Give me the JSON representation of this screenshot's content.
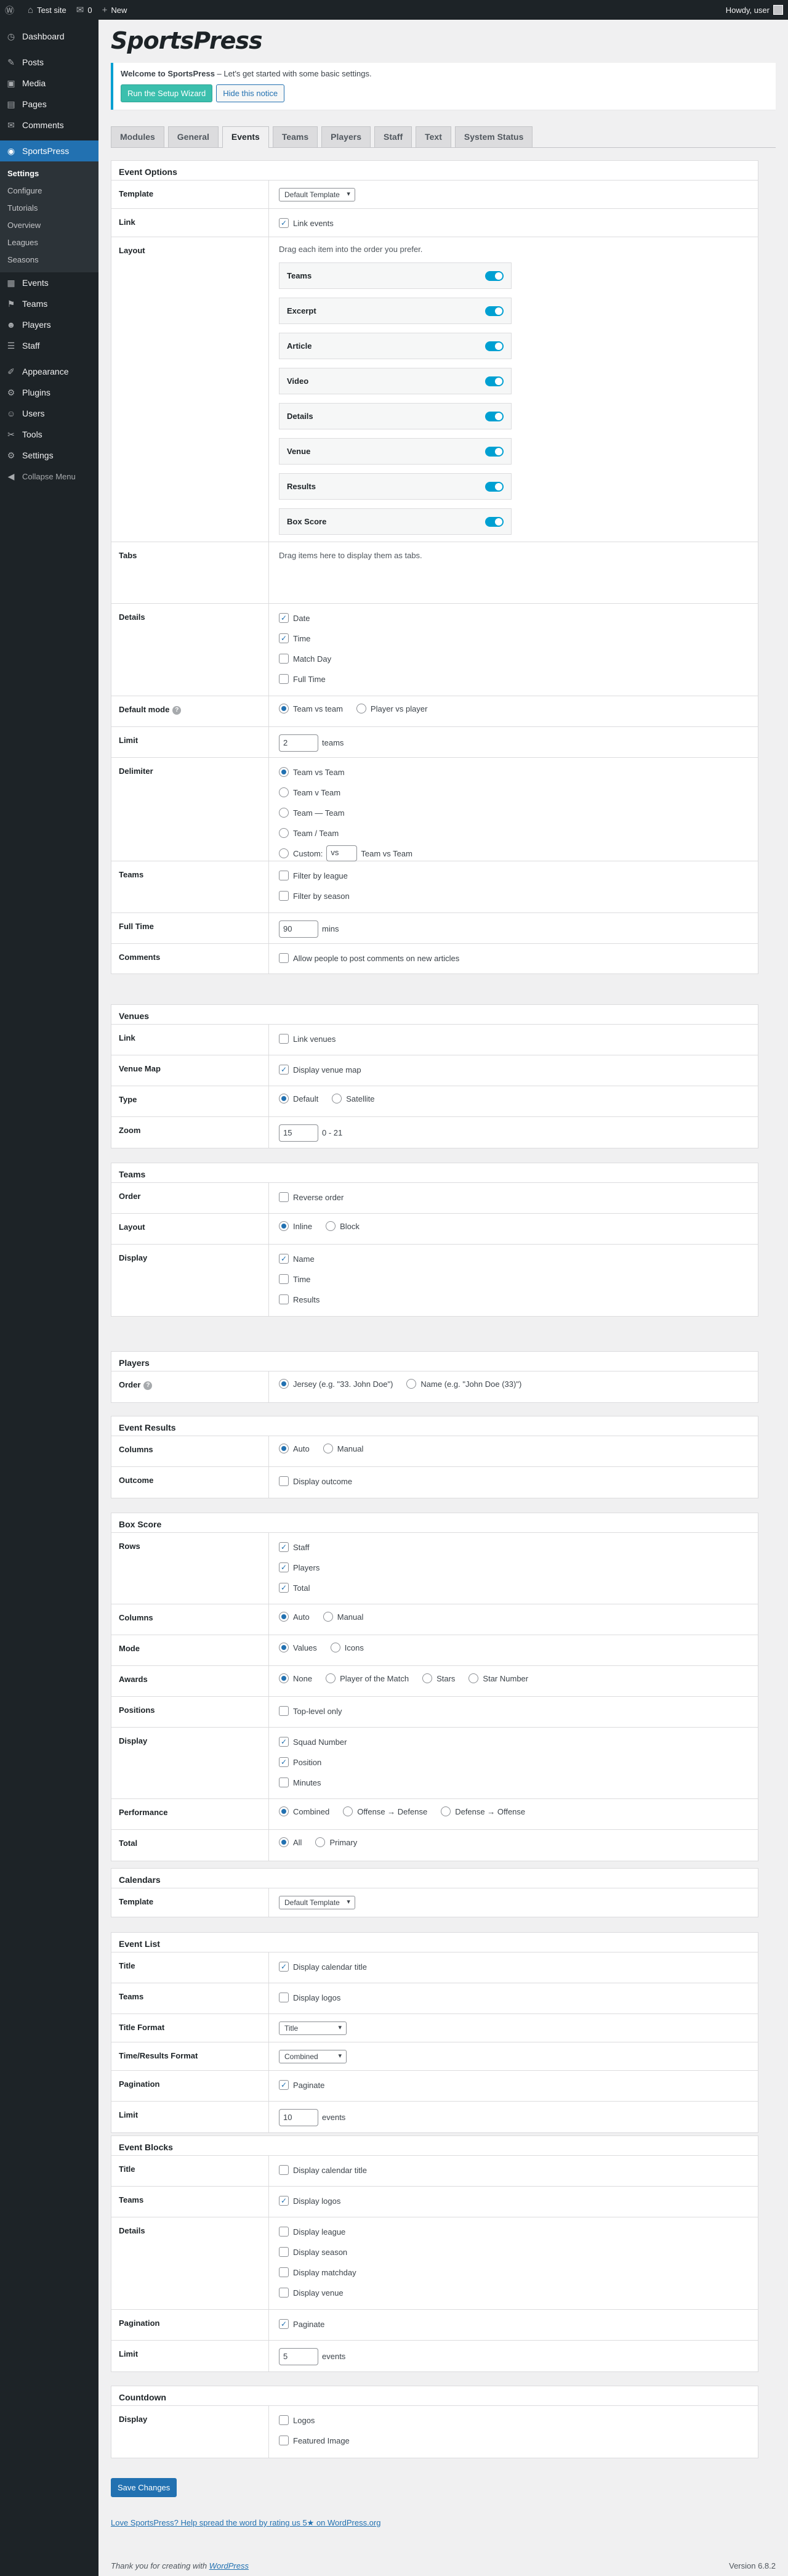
{
  "adminbar": {
    "site": "Test site",
    "comments": "0",
    "new": "New",
    "howdy": "Howdy, user"
  },
  "sidebar": {
    "items": [
      {
        "label": "Dashboard",
        "icon": "dashboard-icon",
        "glyph": "◷"
      },
      {
        "label": "Posts",
        "icon": "pin-icon",
        "glyph": "✎"
      },
      {
        "label": "Media",
        "icon": "media-icon",
        "glyph": "▣"
      },
      {
        "label": "Pages",
        "icon": "page-icon",
        "glyph": "▤"
      },
      {
        "label": "Comments",
        "icon": "comment-icon",
        "glyph": "✉"
      },
      {
        "label": "SportsPress",
        "icon": "sportspress-icon",
        "glyph": "◉"
      },
      {
        "label": "Events",
        "icon": "calendar-icon",
        "glyph": "▦"
      },
      {
        "label": "Teams",
        "icon": "teams-icon",
        "glyph": "⚑"
      },
      {
        "label": "Players",
        "icon": "players-icon",
        "glyph": "☻"
      },
      {
        "label": "Staff",
        "icon": "staff-icon",
        "glyph": "☰"
      },
      {
        "label": "Appearance",
        "icon": "appearance-icon",
        "glyph": "✐"
      },
      {
        "label": "Plugins",
        "icon": "plugins-icon",
        "glyph": "⚙"
      },
      {
        "label": "Users",
        "icon": "users-icon",
        "glyph": "☺"
      },
      {
        "label": "Tools",
        "icon": "tools-icon",
        "glyph": "✂"
      },
      {
        "label": "Settings",
        "icon": "settings-icon",
        "glyph": "⚙"
      }
    ],
    "sub": [
      "Settings",
      "Configure",
      "Tutorials",
      "Overview",
      "Leagues",
      "Seasons"
    ],
    "collapse": "Collapse Menu"
  },
  "logo": "SportsPress",
  "notice": {
    "strong": "Welcome to SportsPress",
    "text": " – Let's get started with some basic settings.",
    "wizard": "Run the Setup Wizard",
    "hide": "Hide this notice"
  },
  "tabs": [
    "Modules",
    "General",
    "Events",
    "Teams",
    "Players",
    "Staff",
    "Text",
    "System Status"
  ],
  "event_options": {
    "title": "Event Options",
    "template_label": "Template",
    "template_value": "Default Template",
    "link_label": "Link",
    "link_opt": "Link events",
    "layout_label": "Layout",
    "layout_hint": "Drag each item into the order you prefer.",
    "layout_items": [
      "Teams",
      "Excerpt",
      "Article",
      "Video",
      "Details",
      "Venue",
      "Results",
      "Box Score"
    ],
    "tabs_label": "Tabs",
    "tabs_hint": "Drag items here to display them as tabs.",
    "details_label": "Details",
    "details_opts": [
      "Date",
      "Time",
      "Match Day",
      "Full Time"
    ],
    "mode_label": "Default mode",
    "mode_opts": [
      "Team vs team",
      "Player vs player"
    ],
    "limit_label": "Limit",
    "limit_value": "2",
    "limit_unit": "teams",
    "delim_label": "Delimiter",
    "delim_opts": [
      "Team vs Team",
      "Team v Team",
      "Team — Team",
      "Team / Team"
    ],
    "custom_label": "Custom:",
    "custom_value": "vs",
    "custom_preview": "Team vs Team",
    "teams_label": "Teams",
    "teams_opts": [
      "Filter by league",
      "Filter by season"
    ],
    "fulltime_label": "Full Time",
    "fulltime_value": "90",
    "fulltime_unit": "mins",
    "comments_label": "Comments",
    "comments_opt": "Allow people to post comments on new articles"
  },
  "venues": {
    "title": "Venues",
    "link_label": "Link",
    "link_opt": "Link venues",
    "map_label": "Venue Map",
    "map_opt": "Display venue map",
    "type_label": "Type",
    "type_opts": [
      "Default",
      "Satellite"
    ],
    "zoom_label": "Zoom",
    "zoom_value": "15",
    "zoom_range": "0 - 21"
  },
  "teams": {
    "title": "Teams",
    "order_label": "Order",
    "order_opt": "Reverse order",
    "layout_label": "Layout",
    "layout_opts": [
      "Inline",
      "Block"
    ],
    "display_label": "Display",
    "display_opts": [
      "Name",
      "Time",
      "Results"
    ]
  },
  "players": {
    "title": "Players",
    "order_label": "Order",
    "order_opts": [
      "Jersey (e.g. \"33. John Doe\")",
      "Name (e.g. \"John Doe (33)\")"
    ]
  },
  "results": {
    "title": "Event Results",
    "columns_label": "Columns",
    "columns_opts": [
      "Auto",
      "Manual"
    ],
    "outcome_label": "Outcome",
    "outcome_opt": "Display outcome"
  },
  "boxscore": {
    "title": "Box Score",
    "rows_label": "Rows",
    "rows_opts": [
      "Staff",
      "Players",
      "Total"
    ],
    "columns_label": "Columns",
    "columns_opts": [
      "Auto",
      "Manual"
    ],
    "mode_label": "Mode",
    "mode_opts": [
      "Values",
      "Icons"
    ],
    "awards_label": "Awards",
    "awards_opts": [
      "None",
      "Player of the Match",
      "Stars",
      "Star Number"
    ],
    "positions_label": "Positions",
    "positions_opt": "Top-level only",
    "display_label": "Display",
    "display_opts": [
      "Squad Number",
      "Position",
      "Minutes"
    ],
    "perf_label": "Performance",
    "perf_opts": [
      "Combined",
      "Offense → Defense",
      "Defense → Offense"
    ],
    "total_label": "Total",
    "total_opts": [
      "All",
      "Primary"
    ]
  },
  "calendars": {
    "title": "Calendars",
    "template_label": "Template",
    "template_value": "Default Template"
  },
  "eventlist": {
    "title": "Event List",
    "title_label": "Title",
    "title_opt": "Display calendar title",
    "teams_label": "Teams",
    "teams_opt": "Display logos",
    "tf_label": "Title Format",
    "tf_value": "Title",
    "trf_label": "Time/Results Format",
    "trf_value": "Combined",
    "pag_label": "Pagination",
    "pag_opt": "Paginate",
    "limit_label": "Limit",
    "limit_value": "10",
    "limit_unit": "events"
  },
  "eventblocks": {
    "title": "Event Blocks",
    "title_label": "Title",
    "title_opt": "Display calendar title",
    "teams_label": "Teams",
    "teams_opt": "Display logos",
    "details_label": "Details",
    "details_opts": [
      "Display league",
      "Display season",
      "Display matchday",
      "Display venue"
    ],
    "pag_label": "Pagination",
    "pag_opt": "Paginate",
    "limit_label": "Limit",
    "limit_value": "5",
    "limit_unit": "events"
  },
  "countdown": {
    "title": "Countdown",
    "display_label": "Display",
    "display_opts": [
      "Logos",
      "Featured Image"
    ]
  },
  "save": "Save Changes",
  "love": "Love SportsPress? Help spread the word by rating us 5★ on WordPress.org",
  "footer": {
    "thanks": "Thank you for creating with ",
    "wp": "WordPress",
    "version": "Version 6.8.2"
  }
}
